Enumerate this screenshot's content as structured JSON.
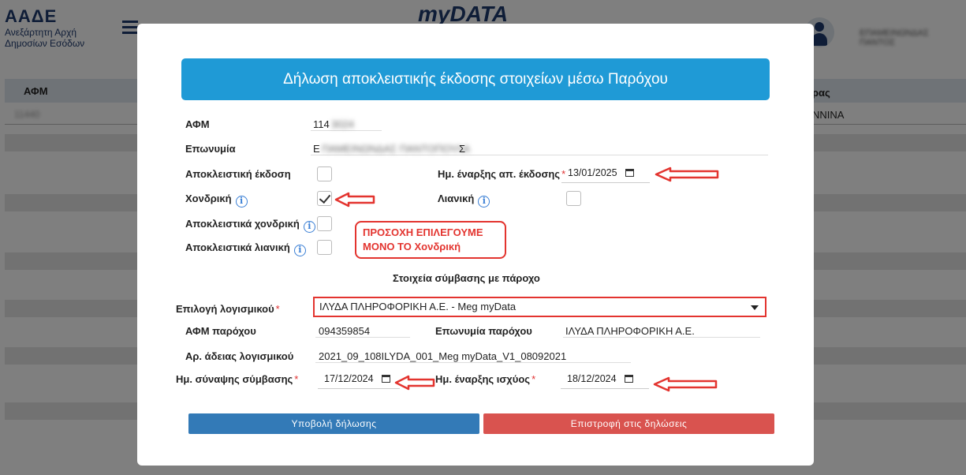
{
  "app": {
    "logo_title": "ΑΑΔΕ",
    "logo_subtitle": "Ανεξάρτητη Αρχή Δημοσίων Εσόδων",
    "brand": "myDATA",
    "user_name": "ΕΠΑΜΕΙΝΩΝΔΑΣ ΠΑΝΤΟΣ"
  },
  "background_table": {
    "col1": "ΑΦΜ",
    "col2": "ρας",
    "row1_afm": "11440",
    "row1_city": "ΝΝΙΝΑ"
  },
  "modal": {
    "title": "Δήλωση αποκλειστικής έκδοσης στοιχείων μέσω Παρόχου",
    "afm_label": "ΑΦΜ",
    "afm_value": "114",
    "afm_value_hidden": "3024",
    "name_label": "Επωνυμία",
    "name_value_start": "Ε",
    "name_value_hidden": "ΠΑΜΕΙΝΩΝΔΑΣ ΠΑΝΤΟΠΟΥΛΑ",
    "name_value_end": "Σ",
    "exclusive_label": "Αποκλειστική έκδοση",
    "start_date_label": "Ημ. έναρξης απ. έκδοσης",
    "start_date_value": "13/01/2025",
    "wholesale_label": "Χονδρική",
    "retail_label": "Λιανική",
    "exclusive_wholesale_label": "Αποκλειστικά χονδρική",
    "exclusive_retail_label": "Αποκλειστικά λιανική",
    "warning_line1": "ΠΡΟΣΟΧΗ ΕΠΙΛΕΓΟΥΜΕ",
    "warning_line2": "ΜΟΝΟ ΤΟ Χονδρική",
    "section_title": "Στοιχεία σύμβασης με πάροχο",
    "software_label": "Επιλογή λογισμικού",
    "software_value": "ΙΛΥΔΑ ΠΛΗΡΟΦΟΡΙΚΗ Α.Ε. - Meg myData",
    "provider_afm_label": "ΑΦΜ παρόχου",
    "provider_afm_value": "094359854",
    "provider_name_label": "Επωνυμία παρόχου",
    "provider_name_value": "ΙΛΥΔΑ ΠΛΗΡΟΦΟΡΙΚΗ Α.Ε.",
    "license_label": "Αρ. άδειας λογισμικού",
    "license_value": "2021_09_108ILYDA_001_Meg myData_V1_08092021",
    "contract_date_label": "Ημ. σύναψης σύμβασης",
    "contract_date_value": "17/12/2024",
    "effective_date_label": "Ημ. έναρξης ισχύος",
    "effective_date_value": "18/12/2024",
    "submit_label": "Υποβολή δήλωσης",
    "back_label": "Επιστροφή στις δηλώσεις",
    "required_mark": "*",
    "info_glyph": "i"
  },
  "state": {
    "exclusive_checked": false,
    "wholesale_checked": true,
    "retail_checked": false,
    "exclusive_wholesale_checked": false,
    "exclusive_retail_checked": false
  },
  "colors": {
    "header_blue": "#1f9ad6",
    "submit_blue": "#337ab7",
    "back_red": "#d9534f",
    "annotation_red": "#e3342f"
  },
  "icons": [
    "calendar-icon",
    "info-icon",
    "chevron-down-icon",
    "hamburger-icon",
    "user-avatar-icon"
  ]
}
